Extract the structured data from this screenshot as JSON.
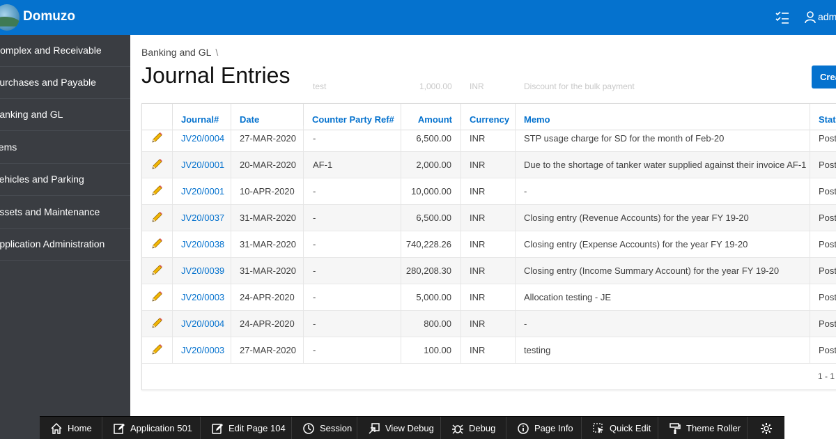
{
  "app": {
    "name": "Domuzo",
    "user": "adm",
    "tasks_icon": "task-list-icon",
    "user_icon": "user-icon"
  },
  "sidebar": {
    "items": [
      {
        "label": "Complex and Receivable"
      },
      {
        "label": "Purchases and Payable"
      },
      {
        "label": "Banking and GL"
      },
      {
        "label": "Items"
      },
      {
        "label": "Vehicles and Parking"
      },
      {
        "label": "Assets and Maintenance"
      },
      {
        "label": "Application Administration"
      }
    ]
  },
  "breadcrumb": {
    "parent": "Banking and GL",
    "separator": "\\"
  },
  "page": {
    "title": "Journal Entries",
    "create_label": "Crea"
  },
  "ghost_row": {
    "memo_frag": "test",
    "amount": "1,000.00",
    "currency": "INR",
    "memo": "Discount for the bulk payment"
  },
  "table": {
    "columns": {
      "journal": "Journal#",
      "date": "Date",
      "ref": "Counter Party Ref#",
      "amount": "Amount",
      "currency": "Currency",
      "memo": "Memo",
      "status": "Statu"
    },
    "rows": [
      {
        "journal": "JV20/0004",
        "date": "27-MAR-2020",
        "ref": "-",
        "amount": "6,500.00",
        "currency": "INR",
        "memo": "STP usage charge for SD for the month of Feb-20",
        "status": "Poste"
      },
      {
        "journal": "JV20/0001",
        "date": "20-MAR-2020",
        "ref": "AF-1",
        "amount": "2,000.00",
        "currency": "INR",
        "memo": "Due to the shortage of tanker water supplied against their invoice AF-1",
        "status": "Poste"
      },
      {
        "journal": "JV20/0001",
        "date": "10-APR-2020",
        "ref": "-",
        "amount": "10,000.00",
        "currency": "INR",
        "memo": "-",
        "status": "Poste"
      },
      {
        "journal": "JV20/0037",
        "date": "31-MAR-2020",
        "ref": "-",
        "amount": "6,500.00",
        "currency": "INR",
        "memo": "Closing entry (Revenue Accounts) for the year FY 19-20",
        "status": "Poste"
      },
      {
        "journal": "JV20/0038",
        "date": "31-MAR-2020",
        "ref": "-",
        "amount": "740,228.26",
        "currency": "INR",
        "memo": "Closing entry (Expense Accounts) for the year FY 19-20",
        "status": "Poste"
      },
      {
        "journal": "JV20/0039",
        "date": "31-MAR-2020",
        "ref": "-",
        "amount": "280,208.30",
        "currency": "INR",
        "memo": "Closing entry (Income Summary Account) for the year FY 19-20",
        "status": "Poste"
      },
      {
        "journal": "JV20/0003",
        "date": "24-APR-2020",
        "ref": "-",
        "amount": "5,000.00",
        "currency": "INR",
        "memo": "Allocation testing - JE",
        "status": "Poste"
      },
      {
        "journal": "JV20/0004",
        "date": "24-APR-2020",
        "ref": "-",
        "amount": "800.00",
        "currency": "INR",
        "memo": "-",
        "status": "Poste"
      },
      {
        "journal": "JV20/0003",
        "date": "27-MAR-2020",
        "ref": "-",
        "amount": "100.00",
        "currency": "INR",
        "memo": "testing",
        "status": "Poste"
      }
    ],
    "edit_icon": "pencil-icon",
    "pagination": "1 - 1"
  },
  "devbar": {
    "items": [
      {
        "label": "Home",
        "icon": "home-icon"
      },
      {
        "label": "Application 501",
        "icon": "edit-app-icon"
      },
      {
        "label": "Edit Page 104",
        "icon": "edit-page-icon"
      },
      {
        "label": "Session",
        "icon": "clock-icon"
      },
      {
        "label": "View Debug",
        "icon": "view-debug-icon"
      },
      {
        "label": "Debug",
        "icon": "bug-icon"
      },
      {
        "label": "Page Info",
        "icon": "info-icon"
      },
      {
        "label": "Quick Edit",
        "icon": "cursor-select-icon"
      },
      {
        "label": "Theme Roller",
        "icon": "paint-roller-icon"
      },
      {
        "label": "",
        "icon": "gear-icon"
      }
    ]
  },
  "colors": {
    "header": "#0572ce",
    "sidebar": "#3a3d42",
    "link": "#0572ce",
    "devbar": "#1f1f1f"
  }
}
